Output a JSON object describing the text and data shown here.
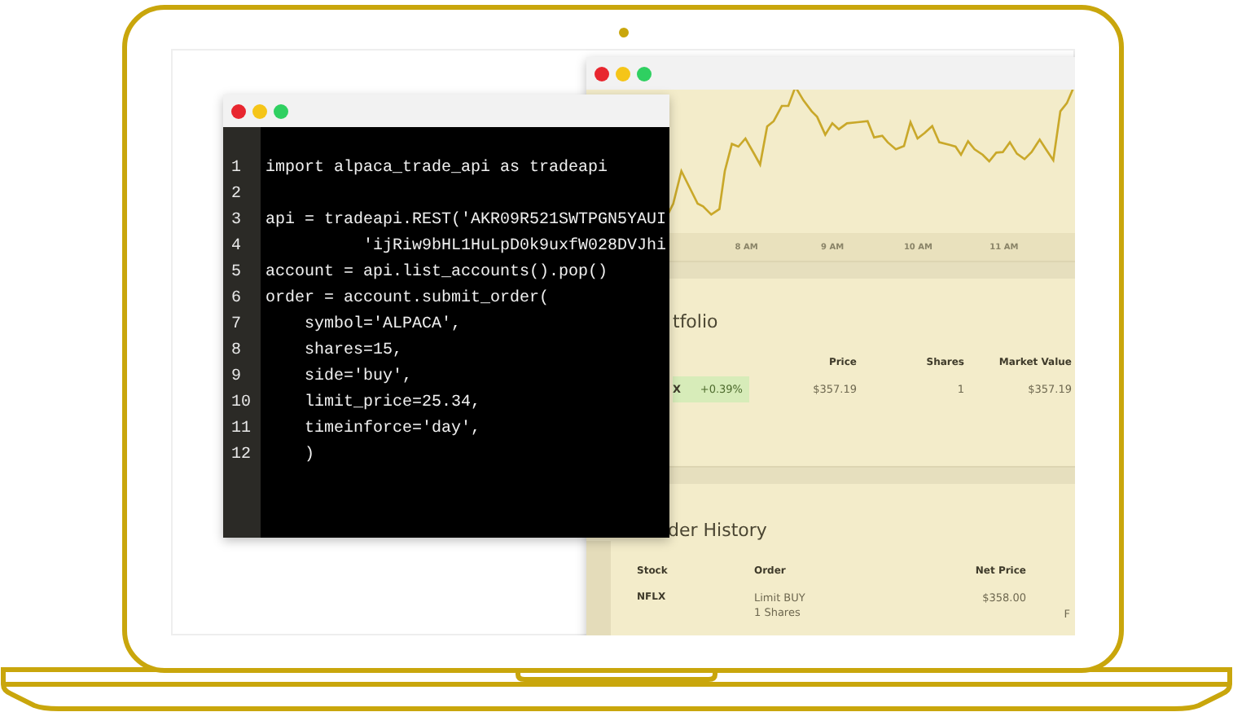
{
  "trading_window": {
    "chart": {
      "time_labels": [
        "8 AM",
        "9 AM",
        "10 AM",
        "11 AM"
      ]
    },
    "portfolio": {
      "title": "tfolio",
      "columns": [
        "Price",
        "Shares",
        "Market Value"
      ],
      "rows": [
        {
          "symbol": "X",
          "change": "+0.39%",
          "positive": true,
          "price": "$357.19",
          "shares": "1",
          "market_value": "$357.19"
        }
      ]
    },
    "order_history": {
      "title": "der History",
      "columns": [
        "Stock",
        "Order",
        "Net Price"
      ],
      "rows": [
        {
          "stock": "NFLX",
          "order": "Limit BUY",
          "quantity": "1 Shares",
          "net_price": "$358.00",
          "column_4": "F"
        }
      ]
    }
  },
  "code_window": {
    "lines": [
      {
        "number": "1",
        "code": "import alpaca_trade_api as tradeapi"
      },
      {
        "number": "2"
      },
      {
        "number": "3",
        "code": "api = tradeapi.REST('AKR09R521SWTPGN5YAUI"
      },
      {
        "number": "4",
        "code": "          'ijRiw9bHL1HuLpD0k9uxfW028DVJhi"
      },
      {
        "number": "5",
        "code": "account = api.list_accounts().pop()"
      },
      {
        "number": "6",
        "code": "order = account.submit_order("
      },
      {
        "number": "7",
        "code": "    symbol='ALPACA',"
      },
      {
        "number": "8",
        "code": "    shares=15,"
      },
      {
        "number": "9",
        "code": "    side='buy',"
      },
      {
        "number": "10",
        "code": "    limit_price=25.34,"
      },
      {
        "number": "11",
        "code": "    timeinforce='day',"
      },
      {
        "number": "12",
        "code": "    )"
      }
    ]
  }
}
